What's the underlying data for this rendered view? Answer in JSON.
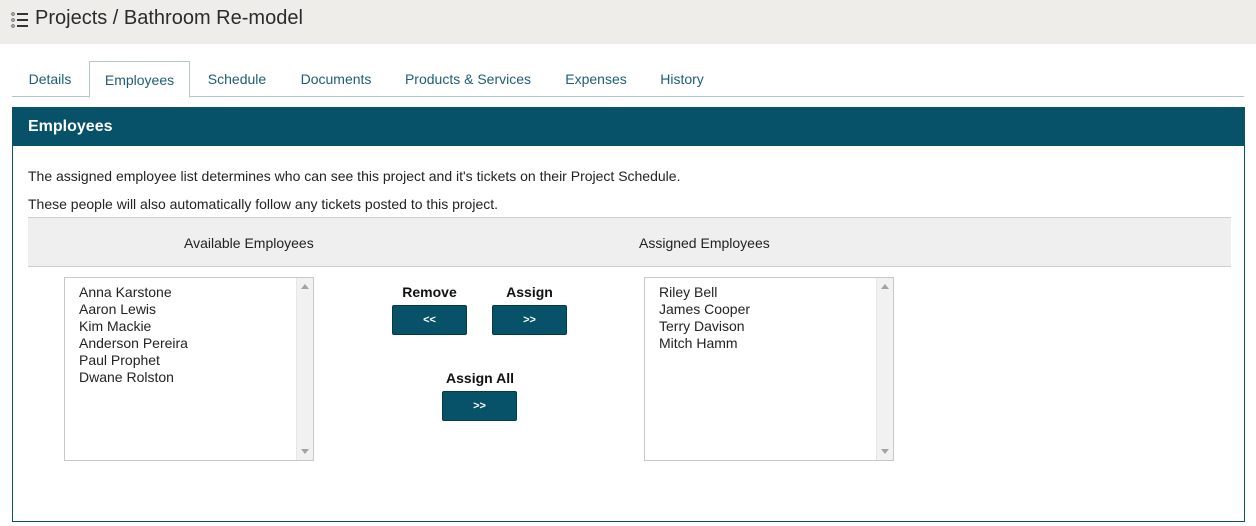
{
  "header": {
    "title": "Projects / Bathroom Re-model"
  },
  "tabs": [
    {
      "label": "Details"
    },
    {
      "label": "Employees"
    },
    {
      "label": "Schedule"
    },
    {
      "label": "Documents"
    },
    {
      "label": "Products & Services"
    },
    {
      "label": "Expenses"
    },
    {
      "label": "History"
    }
  ],
  "active_tab": "Employees",
  "panel": {
    "title": "Employees",
    "desc1": "The assigned employee list determines who can see this project and it's tickets on their Project Schedule.",
    "desc2": "These people will also automatically follow any tickets posted to this project.",
    "available_heading": "Available Employees",
    "assigned_heading": "Assigned Employees",
    "available": [
      "Anna Karstone",
      "Aaron Lewis",
      "Kim Mackie",
      "Anderson Pereira",
      "Paul Prophet",
      "Dwane Rolston"
    ],
    "assigned": [
      "Riley Bell",
      "James Cooper",
      "Terry Davison",
      "Mitch Hamm"
    ],
    "remove_label": "Remove",
    "remove_button": "<<",
    "assign_label": "Assign",
    "assign_button": ">>",
    "assign_all_label": "Assign All",
    "assign_all_button": ">>"
  },
  "colors": {
    "accent": "#075169",
    "topbar": "#efedea",
    "tab_text": "#1d5e74"
  }
}
